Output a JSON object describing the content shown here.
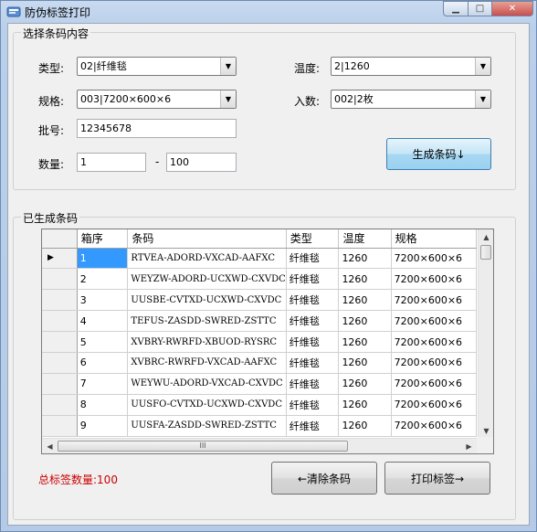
{
  "window": {
    "title": "防伪标签打印"
  },
  "section1": {
    "label": "选择条码内容"
  },
  "form": {
    "type_label": "类型:",
    "type_value": "02|纤维毯",
    "temp_label": "温度:",
    "temp_value": "2|1260",
    "spec_label": "规格:",
    "spec_value": "003|7200×600×6",
    "count_label": "入数:",
    "count_value": "002|2枚",
    "batch_label": "批号:",
    "batch_value": "12345678",
    "qty_label": "数量:",
    "qty_from": "1",
    "qty_dash": "-",
    "qty_to": "100",
    "generate_button": "生成条码↓"
  },
  "section2": {
    "label": "已生成条码"
  },
  "grid": {
    "columns": [
      "箱序",
      "条码",
      "类型",
      "温度",
      "规格"
    ],
    "rows": [
      [
        "1",
        "RTVEA-ADORD-VXCAD-AAFXC",
        "纤维毯",
        "1260",
        "7200×600×6"
      ],
      [
        "2",
        "WEYZW-ADORD-UCXWD-CXVDC",
        "纤维毯",
        "1260",
        "7200×600×6"
      ],
      [
        "3",
        "UUSBE-CVTXD-UCXWD-CXVDC",
        "纤维毯",
        "1260",
        "7200×600×6"
      ],
      [
        "4",
        "TEFUS-ZASDD-SWRED-ZSTTC",
        "纤维毯",
        "1260",
        "7200×600×6"
      ],
      [
        "5",
        "XVBRY-RWRFD-XBUOD-RYSRC",
        "纤维毯",
        "1260",
        "7200×600×6"
      ],
      [
        "6",
        "XVBRC-RWRFD-VXCAD-AAFXC",
        "纤维毯",
        "1260",
        "7200×600×6"
      ],
      [
        "7",
        "WEYWU-ADORD-VXCAD-CXVDC",
        "纤维毯",
        "1260",
        "7200×600×6"
      ],
      [
        "8",
        "UUSFO-CVTXD-UCXWD-CXVDC",
        "纤维毯",
        "1260",
        "7200×600×6"
      ],
      [
        "9",
        "UUSFA-ZASDD-SWRED-ZSTTC",
        "纤维毯",
        "1260",
        "7200×600×6"
      ]
    ],
    "current_row_marker": "▶",
    "hscroll_grip": "III"
  },
  "footer": {
    "total_label": "总标签数量:100",
    "clear_button": "←清除条码",
    "print_button": "打印标签→"
  }
}
